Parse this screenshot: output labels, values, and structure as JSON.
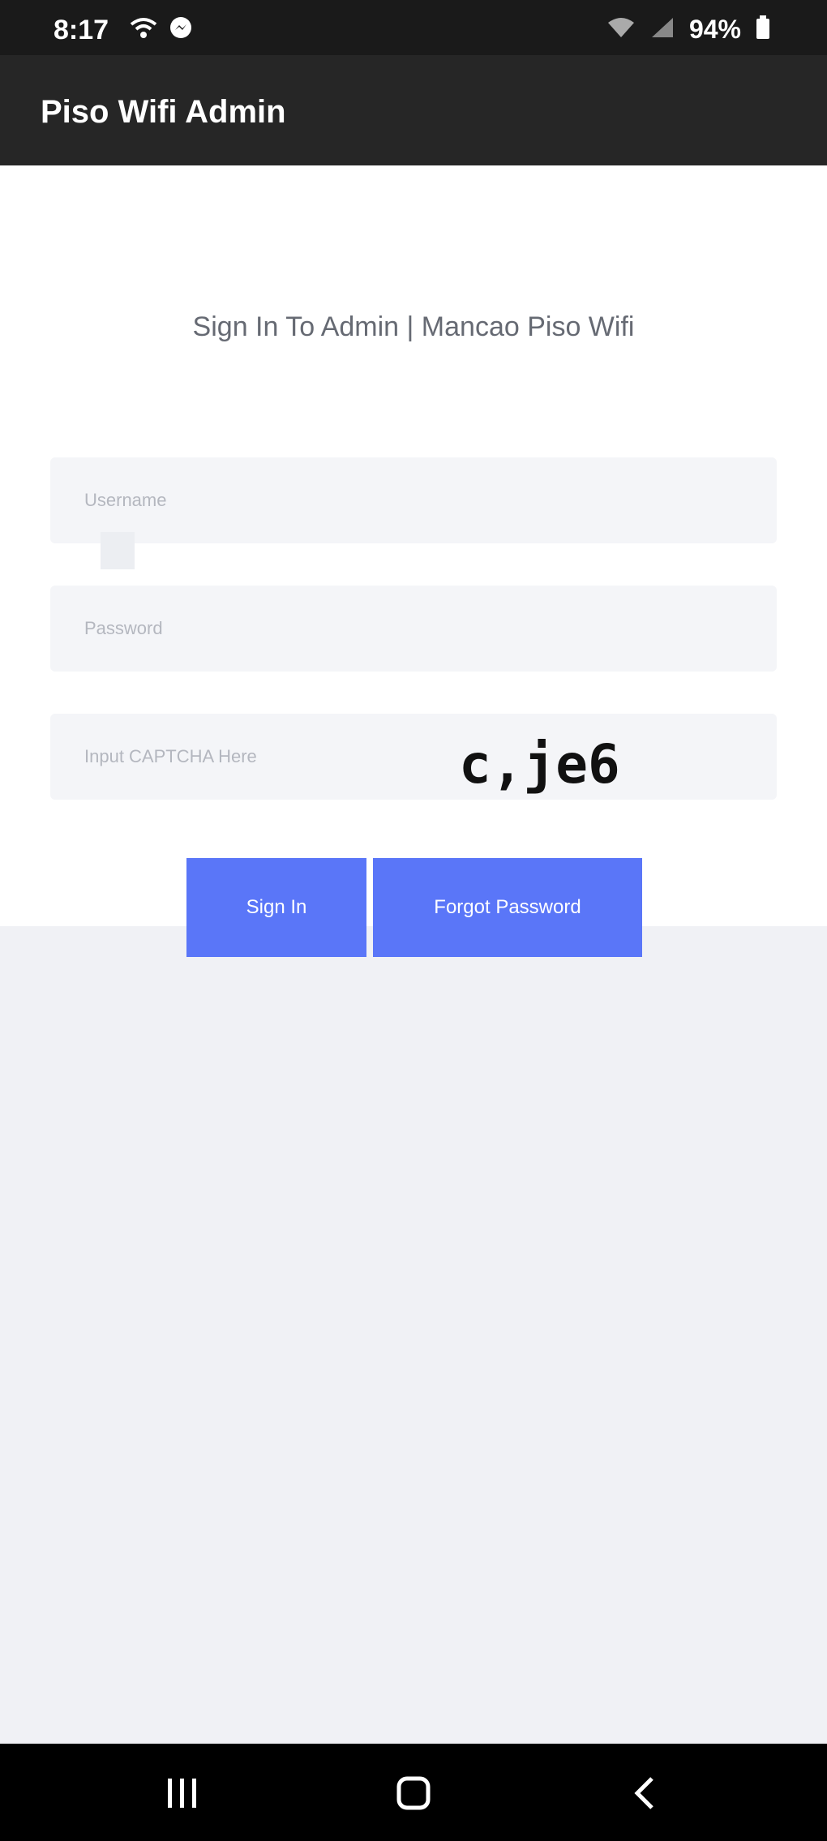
{
  "status_bar": {
    "time": "8:17",
    "battery": "94%",
    "icons": [
      "wifi-call-icon",
      "messenger-icon",
      "wifi-icon",
      "signal-icon",
      "battery-icon"
    ]
  },
  "app_bar": {
    "title": "Piso Wifi Admin"
  },
  "login": {
    "heading": "Sign In To Admin | Mancao Piso Wifi",
    "username_placeholder": "Username",
    "password_placeholder": "Password",
    "captcha_placeholder": "Input CAPTCHA Here",
    "captcha_code": "c,je6",
    "sign_in_label": "Sign In",
    "forgot_password_label": "Forgot Password"
  },
  "nav_bar": {
    "icons": [
      "recent-apps-icon",
      "home-icon",
      "back-icon"
    ]
  },
  "colors": {
    "status_bar_bg": "#1a1a1a",
    "app_bar_bg": "#262626",
    "button_bg": "#5a76f8",
    "page_bg": "#f0f1f5"
  }
}
